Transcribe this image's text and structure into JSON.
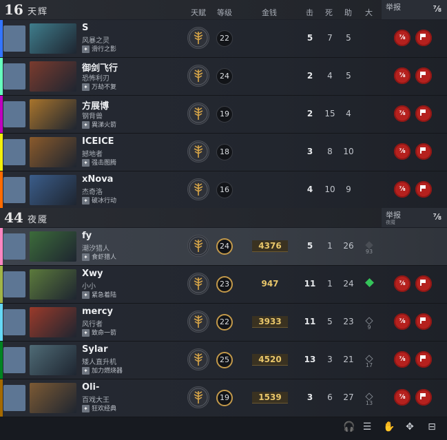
{
  "radiant": {
    "score": "16",
    "name": "天辉",
    "col_talent": "天赋",
    "col_level": "等级",
    "col_gold": "金钱",
    "col_kills": "击",
    "col_deaths": "死",
    "col_assists": "助",
    "col_ult": "大",
    "report_label": "举报",
    "players": [
      {
        "name": "S",
        "hero": "风暴之灵",
        "skill": "滑行之影",
        "level": "22",
        "gold": "",
        "kills": "5",
        "deaths": "7",
        "assists": "5",
        "ult": "",
        "color": "#3375ff",
        "hero_color": "#3f7d8c"
      },
      {
        "name": "御剑飞行",
        "hero": "恐怖利刃",
        "skill": "万劫不复",
        "level": "24",
        "gold": "",
        "kills": "2",
        "deaths": "4",
        "assists": "5",
        "ult": "",
        "color": "#66ffbf",
        "hero_color": "#7a3b2e"
      },
      {
        "name": "方展博",
        "hero": "钢背兽",
        "skill": "異涕火箭",
        "level": "19",
        "gold": "",
        "kills": "2",
        "deaths": "15",
        "assists": "4",
        "ult": "",
        "color": "#bf00bf",
        "hero_color": "#a8742c"
      },
      {
        "name": "ICEICE",
        "hero": "撼地者",
        "skill": "强击图腾",
        "level": "18",
        "gold": "",
        "kills": "3",
        "deaths": "8",
        "assists": "10",
        "ult": "",
        "color": "#f3f00b",
        "hero_color": "#8a5a2b"
      },
      {
        "name": "xNova",
        "hero": "杰奇洛",
        "skill": "破冰行动",
        "level": "16",
        "gold": "",
        "kills": "4",
        "deaths": "10",
        "assists": "9",
        "ult": "",
        "color": "#ff6b00",
        "hero_color": "#3b5d8a"
      }
    ]
  },
  "dire": {
    "score": "44",
    "name": "夜魇",
    "report_label": "举报",
    "report_sub": "夜魇",
    "players": [
      {
        "name": "fy",
        "hero": "潮汐猎人",
        "skill": "食虾猎人",
        "level": "24",
        "gold": "4376",
        "kills": "5",
        "deaths": "1",
        "assists": "26",
        "ult": "93",
        "color": "#fe86c2",
        "hero_color": "#3c6b3a"
      },
      {
        "name": "Xwy",
        "hero": "小小",
        "skill": "紧急着陆",
        "level": "23",
        "gold": "947",
        "kills": "11",
        "deaths": "1",
        "assists": "24",
        "ult": "",
        "color": "#a1b447",
        "hero_color": "#5c7a3c"
      },
      {
        "name": "mercy",
        "hero": "风行者",
        "skill": "致命一箭",
        "level": "22",
        "gold": "3933",
        "kills": "11",
        "deaths": "5",
        "assists": "23",
        "ult": "9",
        "color": "#65d9f7",
        "hero_color": "#9a3a2a"
      },
      {
        "name": "Sylar",
        "hero": "矮人直升机",
        "skill": "加力燃烧器",
        "level": "25",
        "gold": "4520",
        "kills": "13",
        "deaths": "3",
        "assists": "21",
        "ult": "17",
        "color": "#008321",
        "hero_color": "#4f6b76"
      },
      {
        "name": "Oli-",
        "hero": "百戏大王",
        "skill": "狂欢经典",
        "level": "19",
        "gold": "1539",
        "kills": "3",
        "deaths": "6",
        "assists": "27",
        "ult": "13",
        "color": "#a46900",
        "hero_color": "#7c5a34"
      }
    ]
  }
}
